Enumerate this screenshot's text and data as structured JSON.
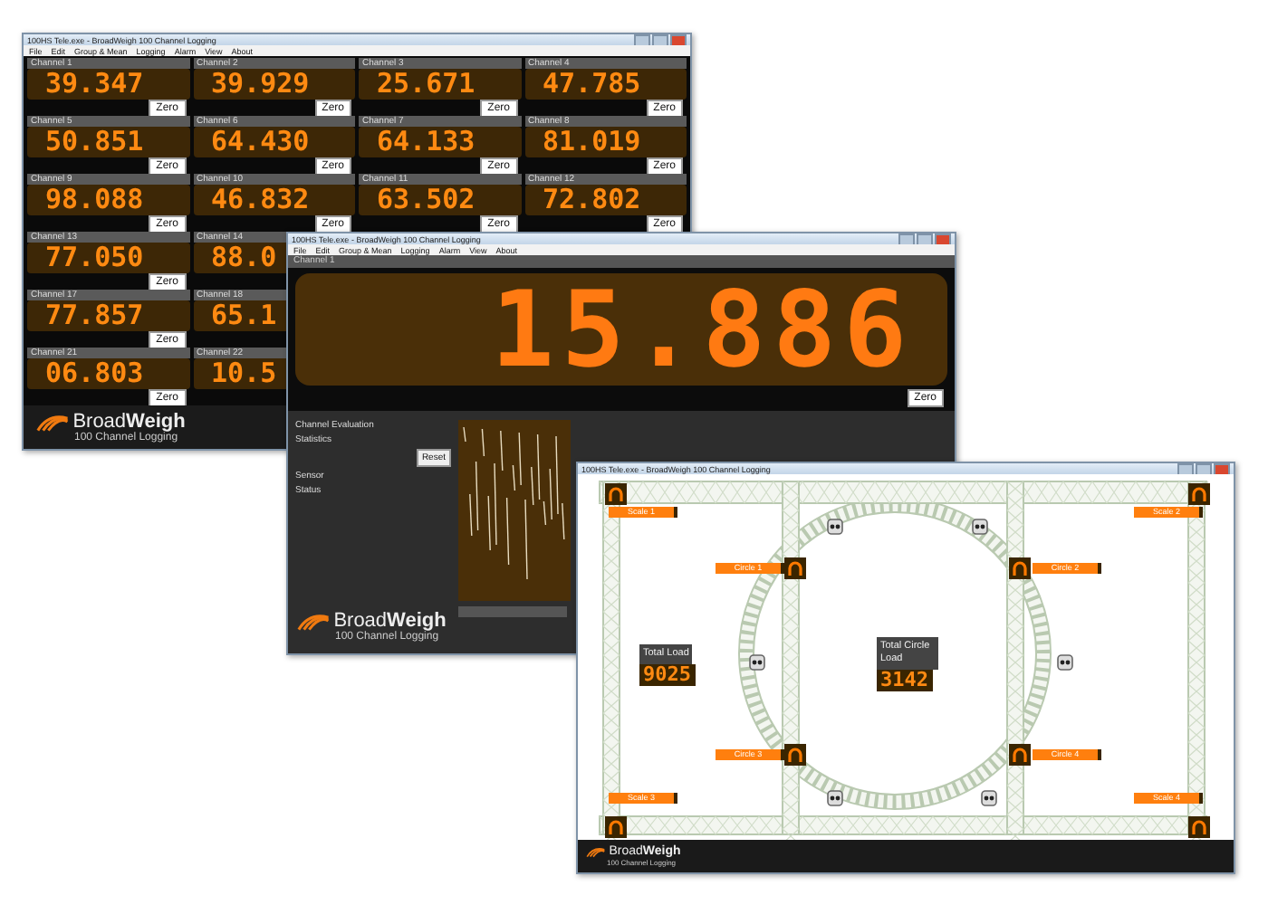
{
  "grid_window": {
    "title": "100HS Tele.exe - BroadWeigh 100 Channel Logging",
    "menu": [
      "File",
      "Edit",
      "Group & Mean",
      "Logging",
      "Alarm",
      "View",
      "About"
    ],
    "rows": [
      {
        "channels": [
          {
            "label": "Channel 1",
            "value": "39.347",
            "button": "Zero"
          },
          {
            "label": "Channel 2",
            "value": "39.929",
            "button": "Zero"
          },
          {
            "label": "Channel 3",
            "value": "25.671",
            "button": "Zero"
          },
          {
            "label": "Channel 4",
            "value": "47.785",
            "button": "Zero"
          }
        ]
      },
      {
        "channels": [
          {
            "label": "Channel 5",
            "value": "50.851",
            "button": "Zero"
          },
          {
            "label": "Channel 6",
            "value": "64.430",
            "button": "Zero"
          },
          {
            "label": "Channel 7",
            "value": "64.133",
            "button": "Zero"
          },
          {
            "label": "Channel 8",
            "value": "81.019",
            "button": "Zero"
          }
        ]
      },
      {
        "channels": [
          {
            "label": "Channel 9",
            "value": "98.088",
            "button": "Zero"
          },
          {
            "label": "Channel 10",
            "value": "46.832",
            "button": "Zero"
          },
          {
            "label": "Channel 11",
            "value": "63.502",
            "button": "Zero"
          },
          {
            "label": "Channel 12",
            "value": "72.802",
            "button": "Zero"
          }
        ]
      },
      {
        "channels": [
          {
            "label": "Channel 13",
            "value": "77.050",
            "button": "Zero"
          },
          {
            "label": "Channel 14",
            "value": "88.0"
          }
        ]
      },
      {
        "channels": [
          {
            "label": "Channel 17",
            "value": "77.857",
            "button": "Zero"
          },
          {
            "label": "Channel 18",
            "value": "65.1"
          }
        ]
      },
      {
        "channels": [
          {
            "label": "Channel 21",
            "value": "06.803",
            "button": "Zero"
          },
          {
            "label": "Channel 22",
            "value": "10.5"
          }
        ]
      }
    ],
    "logo": {
      "name": "Broad**Weigh**",
      "subtitle": "100 Channel Logging"
    }
  },
  "channel_window": {
    "title": "100HS Tele.exe - BroadWeigh 100 Channel Logging",
    "menu": [
      "File",
      "Edit",
      "Group & Mean",
      "Logging",
      "Alarm",
      "View",
      "About"
    ],
    "channel_label": "Channel 1",
    "value": "15.886",
    "button": "Zero",
    "panel": [
      {
        "kind": "heading",
        "text": "Channel Evaluation"
      },
      {
        "kind": "heading",
        "text": "Statistics"
      },
      {
        "kind": "button",
        "text": "Reset"
      },
      {
        "kind": "heading",
        "text": "Sensor"
      },
      {
        "kind": "heading",
        "text": "Status"
      }
    ],
    "logo": {
      "name": "Broad**Weigh**",
      "subtitle": "100 Channel Logging"
    }
  },
  "layout_window": {
    "title": "100HS Tele.exe - BroadWeigh 100 Channel Logging",
    "scales": [
      {
        "label": "Scale 1"
      },
      {
        "label": "Scale 2"
      },
      {
        "label": "Circle 1"
      },
      {
        "label": "Circle 2"
      },
      {
        "label": "Circle 3"
      },
      {
        "label": "Circle 4"
      },
      {
        "label": "Scale 3"
      },
      {
        "label": "Scale 4"
      }
    ],
    "loads": [
      {
        "label": "Total Load",
        "value": "9025"
      },
      {
        "label": "Total Circle Load",
        "value": "3142"
      }
    ],
    "logo": {
      "name": "Broad**Weigh**",
      "subtitle": "100 Channel Logging"
    }
  }
}
